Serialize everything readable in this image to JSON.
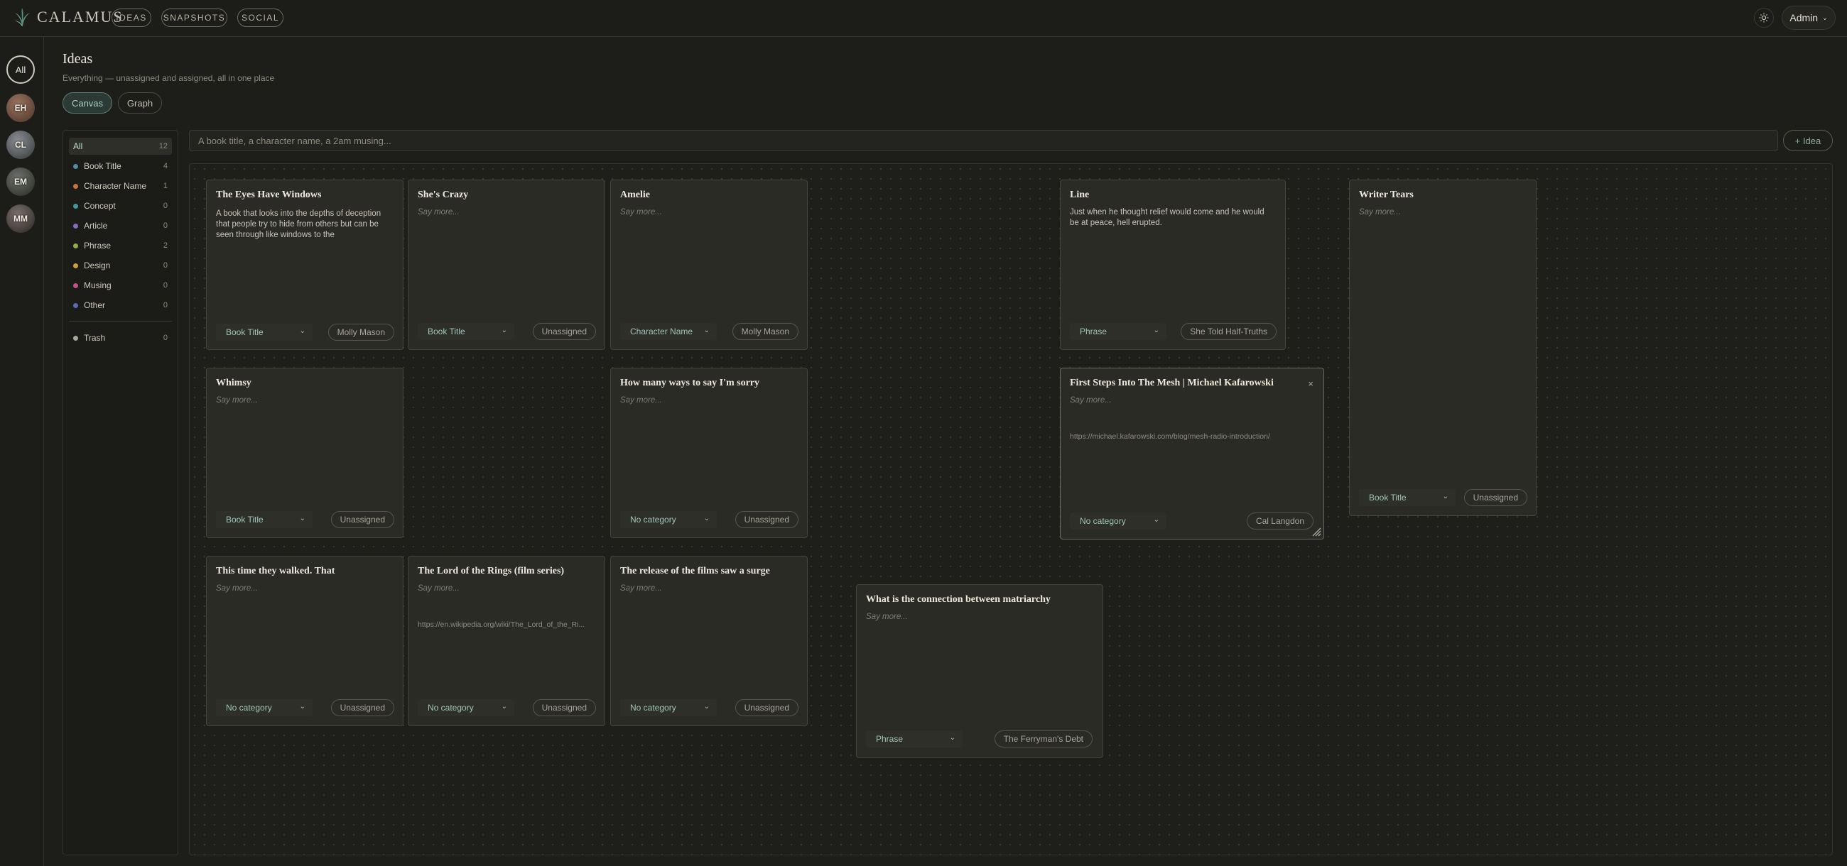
{
  "app": {
    "name": "CALAMUS",
    "nav": [
      {
        "label": "IDEAS"
      },
      {
        "label": "SNAPSHOTS"
      },
      {
        "label": "SOCIAL"
      }
    ],
    "user_menu": "Admin"
  },
  "rail": {
    "all_label": "All",
    "avatars": [
      {
        "initials": "EH",
        "color": "#6b4a3a"
      },
      {
        "initials": "CL",
        "color": "#5a5e62"
      },
      {
        "initials": "EM",
        "color": "#3e423e"
      },
      {
        "initials": "MM",
        "color": "#4a4440"
      }
    ]
  },
  "header": {
    "title": "Ideas",
    "subtitle": "Everything — unassigned and assigned, all in one place",
    "tabs": [
      {
        "label": "Canvas",
        "active": true
      },
      {
        "label": "Graph",
        "active": false
      }
    ]
  },
  "categories": [
    {
      "label": "All",
      "count": "12",
      "color": null,
      "active": true
    },
    {
      "label": "Book Title",
      "count": "4",
      "color": "#4e8aa3"
    },
    {
      "label": "Character Name",
      "count": "1",
      "color": "#c8733c"
    },
    {
      "label": "Concept",
      "count": "0",
      "color": "#3f9a9e"
    },
    {
      "label": "Article",
      "count": "0",
      "color": "#8a6ac0"
    },
    {
      "label": "Phrase",
      "count": "2",
      "color": "#8fae4a"
    },
    {
      "label": "Design",
      "count": "0",
      "color": "#c9a23a"
    },
    {
      "label": "Musing",
      "count": "0",
      "color": "#c4508a"
    },
    {
      "label": "Other",
      "count": "0",
      "color": "#5a6ab8"
    }
  ],
  "trash": {
    "label": "Trash",
    "count": "0",
    "color": "#a8a497"
  },
  "input": {
    "placeholder": "A book title, a character name, a 2am musing...",
    "add_label": "+ Idea"
  },
  "cards": [
    {
      "title": "The Eyes Have Windows",
      "body": "A book that looks into the depths of deception that people try to hide from others but can be seen through like windows to the",
      "category": "Book Title",
      "assignee": "Molly Mason"
    },
    {
      "title": "She's Crazy",
      "body": "Say more...",
      "category": "Book Title",
      "assignee": "Unassigned"
    },
    {
      "title": "Amelie",
      "body": "Say more...",
      "category": "Character Name",
      "assignee": "Molly Mason"
    },
    {
      "title": "Line",
      "body": "Just when he thought relief would come and he would be at peace, hell erupted.",
      "category": "Phrase",
      "assignee": "She Told Half-Truths"
    },
    {
      "title": "Writer Tears",
      "body": "Say more...",
      "category": "Book Title",
      "assignee": "Unassigned"
    },
    {
      "title": "Whimsy",
      "body": "Say more...",
      "category": "Book Title",
      "assignee": "Unassigned"
    },
    {
      "title": "How many ways to say I'm sorry",
      "body": "Say more...",
      "category": "No category",
      "assignee": "Unassigned"
    },
    {
      "title": "First Steps Into The Mesh | Michael Kafarowski",
      "body": "Say more...",
      "link": "https://michael.kafarowski.com/blog/mesh-radio-introduction/",
      "category": "No category",
      "assignee": "Cal Langdon",
      "close": "×"
    },
    {
      "title": "This time they walked. That",
      "body": "Say more...",
      "category": "No category",
      "assignee": "Unassigned"
    },
    {
      "title": "The Lord of the Rings (film series)",
      "body": "Say more...",
      "link": "https://en.wikipedia.org/wiki/The_Lord_of_the_Ri...",
      "category": "No category",
      "assignee": "Unassigned"
    },
    {
      "title": "The release of the films saw a surge",
      "body": "Say more...",
      "category": "No category",
      "assignee": "Unassigned"
    },
    {
      "title": "What is the connection between matriarchy",
      "body": "Say more...",
      "category": "Phrase",
      "assignee": "The Ferryman's Debt"
    }
  ]
}
